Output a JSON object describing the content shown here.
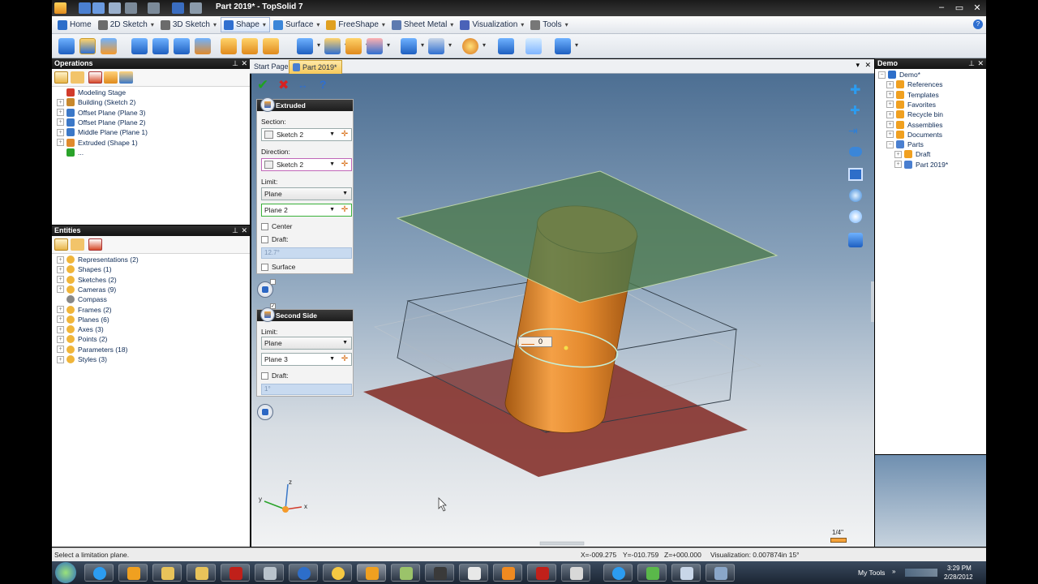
{
  "window": {
    "title": "Part 2019* - TopSolid 7"
  },
  "ribbon": {
    "tabs": [
      {
        "label": "Home",
        "color": "#2d6ec9"
      },
      {
        "label": "2D Sketch",
        "color": "#6b6b6b"
      },
      {
        "label": "3D Sketch",
        "color": "#6b6b6b"
      },
      {
        "label": "Shape",
        "color": "#2f6fd0"
      },
      {
        "label": "Surface",
        "color": "#3b86d8"
      },
      {
        "label": "FreeShape",
        "color": "#e0a020"
      },
      {
        "label": "Sheet Metal",
        "color": "#5d7ab0"
      },
      {
        "label": "Visualization",
        "color": "#4a62b8"
      },
      {
        "label": "Tools",
        "color": "#777777"
      }
    ],
    "active_tab": "Shape"
  },
  "operations_panel": {
    "title": "Operations",
    "items": [
      {
        "label": "Modeling Stage",
        "icon": "stage-arrow-icon",
        "color": "#d23b2b",
        "expandable": false
      },
      {
        "label": "Building (Sketch 2)",
        "icon": "sketch-icon",
        "color": "#c8882c",
        "expandable": true
      },
      {
        "label": "Offset Plane (Plane 3)",
        "icon": "plane-icon",
        "color": "#3b78c8",
        "expandable": true
      },
      {
        "label": "Offset Plane (Plane 2)",
        "icon": "plane-icon",
        "color": "#3b78c8",
        "expandable": true
      },
      {
        "label": "Middle Plane (Plane 1)",
        "icon": "plane-icon",
        "color": "#3b78c8",
        "expandable": true
      },
      {
        "label": "Extruded (Shape 1)",
        "icon": "extrude-icon",
        "color": "#e08a2c",
        "expandable": true
      },
      {
        "label": "...",
        "icon": "green-arrow-icon",
        "color": "#2aa32a",
        "expandable": false
      }
    ]
  },
  "entities_panel": {
    "title": "Entities",
    "items": [
      {
        "label": "Representations (2)",
        "expandable": true
      },
      {
        "label": "Shapes (1)",
        "expandable": true
      },
      {
        "label": "Sketches (2)",
        "expandable": true
      },
      {
        "label": "Cameras (9)",
        "expandable": true
      },
      {
        "label": "Compass",
        "expandable": false
      },
      {
        "label": "Frames (2)",
        "expandable": true
      },
      {
        "label": "Planes (6)",
        "expandable": true
      },
      {
        "label": "Axes (3)",
        "expandable": true
      },
      {
        "label": "Points (2)",
        "expandable": true
      },
      {
        "label": "Parameters (18)",
        "expandable": true
      },
      {
        "label": "Styles (3)",
        "expandable": true
      }
    ]
  },
  "doc_tabs": [
    {
      "label": "Start Page",
      "active": false
    },
    {
      "label": "Part 2019*",
      "active": true
    }
  ],
  "extruded_dialog": {
    "title": "Extruded",
    "section_label": "Section:",
    "section_value": "Sketch 2",
    "direction_label": "Direction:",
    "direction_value": "Sketch 2",
    "limit_label": "Limit:",
    "limit_type": "Plane",
    "limit_value": "Plane 2",
    "center_label": "Center",
    "draft_label": "Draft:",
    "draft_value": "12.7°",
    "surface_label": "Surface"
  },
  "second_side_dialog": {
    "title": "Second Side",
    "limit_label": "Limit:",
    "limit_type": "Plane",
    "limit_value": "Plane 3",
    "draft_label": "Draft:",
    "draft_value": "1°"
  },
  "viewport": {
    "distance_value": "0",
    "scale_label": "1/4\"",
    "axes": {
      "x": "x",
      "y": "y",
      "z": "z"
    }
  },
  "demo_panel": {
    "title": "Demo",
    "items": [
      {
        "label": "Demo*",
        "level": 0
      },
      {
        "label": "References",
        "level": 1
      },
      {
        "label": "Templates",
        "level": 1
      },
      {
        "label": "Favorites",
        "level": 1
      },
      {
        "label": "Recycle bin",
        "level": 1
      },
      {
        "label": "Assemblies",
        "level": 1
      },
      {
        "label": "Documents",
        "level": 1
      },
      {
        "label": "Parts",
        "level": 1
      },
      {
        "label": "Draft",
        "level": 2
      },
      {
        "label": "Part 2019*",
        "level": 2
      }
    ]
  },
  "statusbar": {
    "message": "Select a limitation plane.",
    "x": "X=-009.275",
    "y": "Y=-010.759",
    "z": "Z=+000.000",
    "visualization": "Visualization: 0.007874in 15°"
  },
  "taskbar": {
    "my_tools": "My Tools",
    "time": "3:29 PM",
    "date": "2/28/2012"
  },
  "colors": {
    "green_plane": "#4d7a4c",
    "red_plane": "#8a3b36",
    "cylinder": "#e28a2e",
    "accent_blue": "#2f6fd0"
  }
}
